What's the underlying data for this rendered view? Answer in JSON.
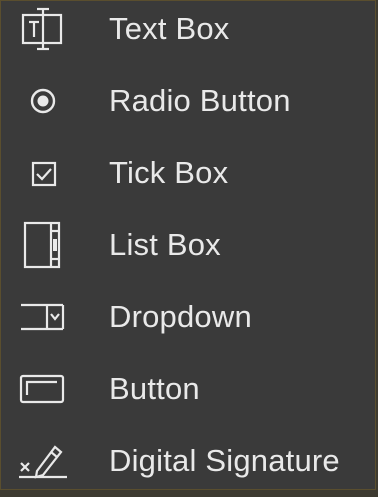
{
  "menu": {
    "items": [
      {
        "label": "Text Box",
        "icon": "text-box-icon"
      },
      {
        "label": "Radio Button",
        "icon": "radio-button-icon"
      },
      {
        "label": "Tick Box",
        "icon": "tick-box-icon"
      },
      {
        "label": "List Box",
        "icon": "list-box-icon"
      },
      {
        "label": "Dropdown",
        "icon": "dropdown-icon"
      },
      {
        "label": "Button",
        "icon": "button-icon"
      },
      {
        "label": "Digital Signature",
        "icon": "digital-signature-icon"
      }
    ]
  },
  "colors": {
    "background": "#3a3a3a",
    "text": "#e9e9e9",
    "border": "#5a4e2e"
  }
}
